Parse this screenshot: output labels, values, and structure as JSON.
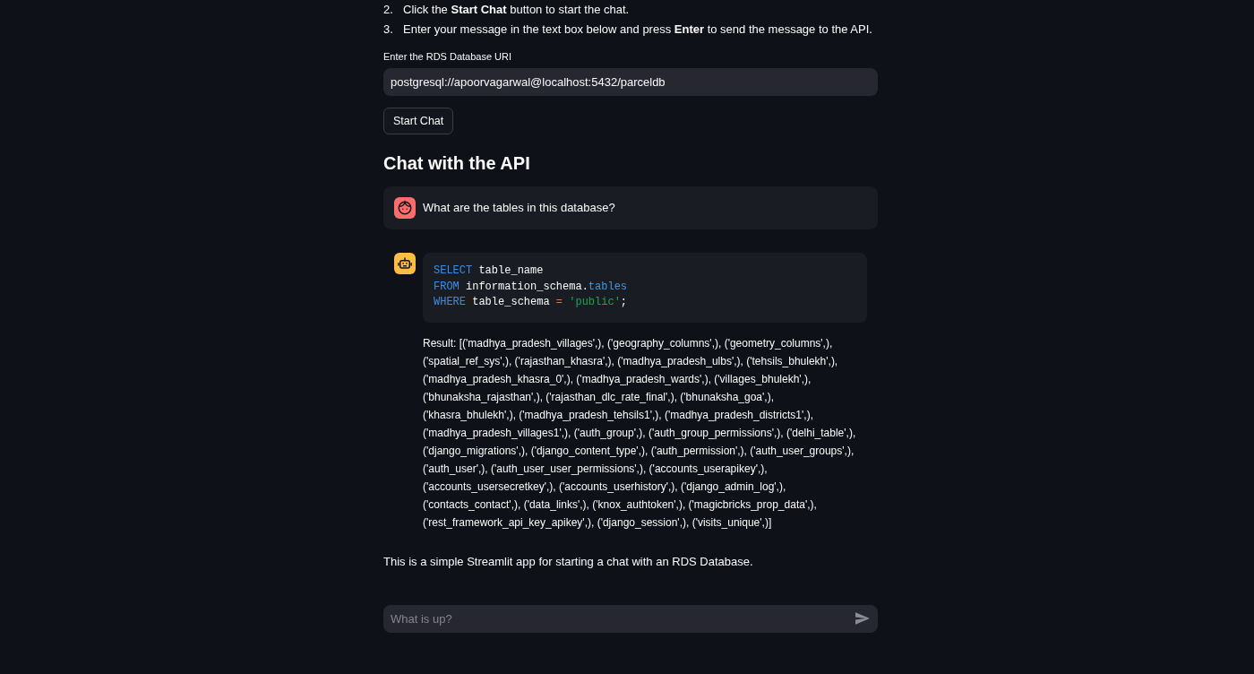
{
  "instructions": [
    {
      "number": "2.",
      "text": "Click the **Start Chat** button to start the chat."
    },
    {
      "number": "3.",
      "text": "Enter your message in the text box below and press **Enter** to send the message to the API."
    }
  ],
  "uri_field": {
    "label": "Enter the RDS Database URI",
    "value": "postgresql://apoorvagarwal@localhost:5432/parceldb"
  },
  "start_button": {
    "label": "Start Chat"
  },
  "chat_heading": "Chat with the API",
  "messages": [
    {
      "kind": "user",
      "text": "What are the tables in this database?"
    },
    {
      "kind": "assistant",
      "code": [
        [
          {
            "kind": "keyword",
            "text": "SELECT"
          },
          {
            "kind": "plain",
            "text": " table_name"
          }
        ],
        [
          {
            "kind": "keyword",
            "text": "FROM"
          },
          {
            "kind": "plain",
            "text": " information_schema."
          },
          {
            "kind": "attribute",
            "text": "tables"
          }
        ],
        [
          {
            "kind": "keyword",
            "text": "WHERE"
          },
          {
            "kind": "plain",
            "text": " table_schema "
          },
          {
            "kind": "operator",
            "text": "="
          },
          {
            "kind": "string",
            "text": " 'public'"
          },
          {
            "kind": "plain",
            "text": ";"
          }
        ]
      ],
      "result": "Result: [('madhya_pradesh_villages',), ('geography_columns',), ('geometry_columns',), ('spatial_ref_sys',), ('rajasthan_khasra',), ('madhya_pradesh_ulbs',), ('tehsils_bhulekh',), ('madhya_pradesh_khasra_0',), ('madhya_pradesh_wards',), ('villages_bhulekh',), ('bhunaksha_rajasthan',), ('rajasthan_dlc_rate_final',), ('bhunaksha_goa',), ('khasra_bhulekh',), ('madhya_pradesh_tehsils1',), ('madhya_pradesh_districts1',), ('madhya_pradesh_villages1',), ('auth_group',), ('auth_group_permissions',), ('delhi_table',), ('django_migrations',), ('django_content_type',), ('auth_permission',), ('auth_user_groups',), ('auth_user',), ('auth_user_user_permissions',), ('accounts_userapikey',), ('accounts_usersecretkey',), ('accounts_userhistory',), ('django_admin_log',), ('contacts_contact',), ('data_links',), ('knox_authtoken',), ('magicbricks_prop_data',), ('rest_framework_api_key_apikey',), ('django_session',), ('visits_unique',)]"
    }
  ],
  "footer_text": "This is a simple Streamlit app for starting a chat with an RDS Database.",
  "chat_input": {
    "placeholder": "What is up?"
  }
}
